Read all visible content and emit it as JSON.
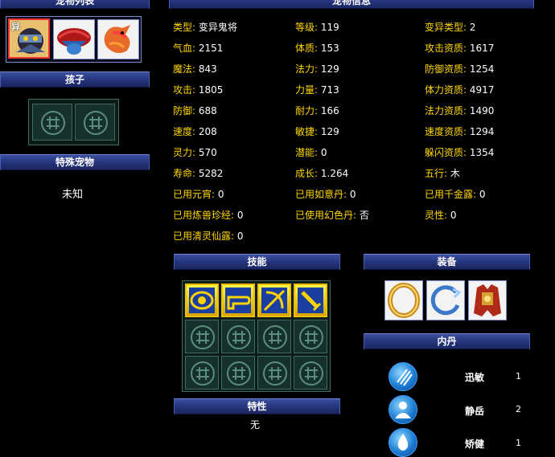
{
  "headers": {
    "pet_list": "宠物列表",
    "pet_info": "宠物信息",
    "children": "孩子",
    "special_pets": "特殊宠物",
    "skills": "技能",
    "equipment": "装备",
    "inner_elixir": "内丹",
    "traits": "特性"
  },
  "special_pets_value": "未知",
  "traits_value": "无",
  "attributes": {
    "col1": [
      {
        "k": "类型:",
        "v": "变异鬼将"
      },
      {
        "k": "气血:",
        "v": "2151"
      },
      {
        "k": "魔法:",
        "v": "843"
      },
      {
        "k": "攻击:",
        "v": "1805"
      },
      {
        "k": "防御:",
        "v": "688"
      },
      {
        "k": "速度:",
        "v": "208"
      },
      {
        "k": "灵力:",
        "v": "570"
      },
      {
        "k": "寿命:",
        "v": "5282"
      },
      {
        "k": "已用元宵:",
        "v": "0"
      },
      {
        "k": "已用炼兽珍经:",
        "v": "0"
      },
      {
        "k": "已用清灵仙露:",
        "v": "0"
      }
    ],
    "col2": [
      {
        "k": "等级:",
        "v": "119"
      },
      {
        "k": "体质:",
        "v": "153"
      },
      {
        "k": "法力:",
        "v": "129"
      },
      {
        "k": "力量:",
        "v": "713"
      },
      {
        "k": "耐力:",
        "v": "166"
      },
      {
        "k": "敏捷:",
        "v": "129"
      },
      {
        "k": "潜能:",
        "v": "0"
      },
      {
        "k": "成长:",
        "v": "1.264"
      },
      {
        "k": "已用如意丹:",
        "v": "0"
      },
      {
        "k": "已使用幻色丹:",
        "v": "否"
      }
    ],
    "col3": [
      {
        "k": "变异类型:",
        "v": "2"
      },
      {
        "k": "攻击资质:",
        "v": "1617"
      },
      {
        "k": "防御资质:",
        "v": "1254"
      },
      {
        "k": "体力资质:",
        "v": "4917"
      },
      {
        "k": "法力资质:",
        "v": "1490"
      },
      {
        "k": "速度资质:",
        "v": "1294"
      },
      {
        "k": "躲闪资质:",
        "v": "1354"
      },
      {
        "k": "五行:",
        "v": "木"
      },
      {
        "k": "已用千金露:",
        "v": "0"
      },
      {
        "k": "灵性:",
        "v": "0"
      }
    ]
  },
  "pet_slots": [
    {
      "icon": "ghost-general-pet-icon",
      "badge": "异"
    },
    {
      "icon": "feathered-creature-pet-icon"
    },
    {
      "icon": "phoenix-bird-pet-icon"
    }
  ],
  "skills": [
    {
      "icon": "eye-skill-icon"
    },
    {
      "icon": "bow-arch-skill-icon"
    },
    {
      "icon": "crossed-bow-skill-icon"
    },
    {
      "icon": "sword-skill-icon"
    }
  ],
  "equipment": [
    {
      "icon": "gold-ring-equipment-icon"
    },
    {
      "icon": "blue-loop-equipment-icon"
    },
    {
      "icon": "red-armor-equipment-icon"
    }
  ],
  "inner_elixirs": [
    {
      "name": "迅敏",
      "level": "1",
      "icon": "claw-strike-icon"
    },
    {
      "name": "静岳",
      "level": "2",
      "icon": "mountain-figure-icon"
    },
    {
      "name": "矫健",
      "level": "1",
      "icon": "water-drop-icon"
    }
  ],
  "colors": {
    "header_bg": "#24337a",
    "label": "#ffd600",
    "value": "#ffffff",
    "cell": "#16302c"
  }
}
